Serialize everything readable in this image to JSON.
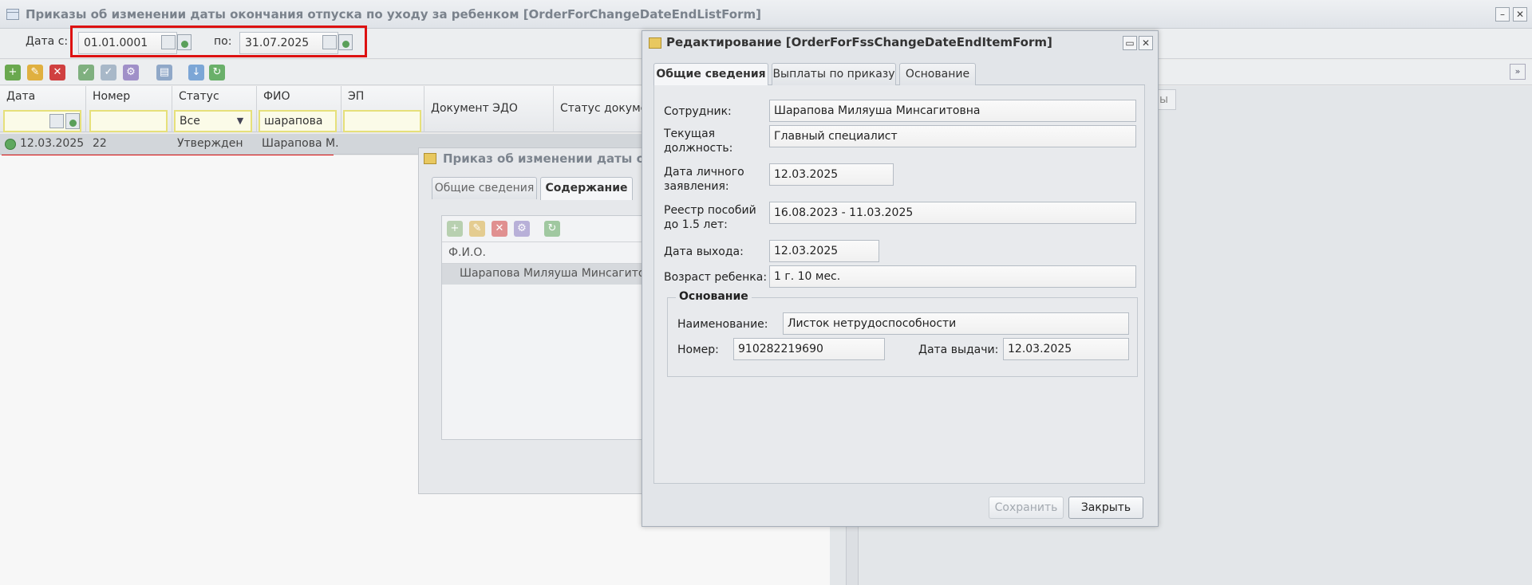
{
  "main_window": {
    "title": "Приказы об изменении даты окончания отпуска по уходу за ребенком [OrderForChangeDateEndListForm]",
    "minimize_glyph": "–",
    "close_glyph": "✕"
  },
  "filter": {
    "date_from_label": "Дата с:",
    "date_from_value": "01.01.0001",
    "date_to_label": "по:",
    "date_to_value": "31.07.2025"
  },
  "toolbar": {
    "icons": [
      "add-icon",
      "edit-icon",
      "delete-icon",
      "approve-icon",
      "unapprove-icon",
      "actions-icon",
      "print-icon",
      "export-icon",
      "refresh-icon"
    ]
  },
  "grid": {
    "columns": [
      "Дата",
      "Номер",
      "Статус",
      "ФИО",
      "ЭП",
      "Документ ЭДО",
      "Статус документ"
    ],
    "filters": {
      "status_value": "Все",
      "fio_value": "шарапова"
    },
    "rows": [
      {
        "date": "12.03.2025",
        "number": "22",
        "status": "Утвержден",
        "fio": "Шарапова М..."
      }
    ]
  },
  "bg_window": {
    "title": "Приказ об изменении даты оконча",
    "tabs": [
      "Общие сведения",
      "Содержание"
    ],
    "column": "Ф.И.О.",
    "row": "Шарапова Миляуша Минсагитовна",
    "right_tab_fragment": "ы"
  },
  "modal": {
    "title": "Редактирование [OrderForFssChangeDateEndItemForm]",
    "tabs": [
      "Общие сведения",
      "Выплаты по приказу",
      "Основание"
    ],
    "fields": {
      "employee_label": "Сотрудник:",
      "employee_value": "Шарапова Миляуша Минсагитовна",
      "position_label_1": "Текущая",
      "position_label_2": "должность:",
      "position_value": "Главный специалист",
      "app_date_label_1": "Дата личного",
      "app_date_label_2": "заявления:",
      "app_date_value": "12.03.2025",
      "registry_label_1": "Реестр пособий",
      "registry_label_2": "до 1.5 лет:",
      "registry_value": "16.08.2023 - 11.03.2025",
      "return_date_label": "Дата выхода:",
      "return_date_value": "12.03.2025",
      "child_age_label": "Возраст ребенка:",
      "child_age_value": "1 г. 10 мес."
    },
    "basis": {
      "legend": "Основание",
      "name_label": "Наименование:",
      "name_value": "Листок нетрудоспособности",
      "number_label": "Номер:",
      "number_value": "910282219690",
      "issue_date_label": "Дата выдачи:",
      "issue_date_value": "12.03.2025"
    },
    "buttons": {
      "save": "Сохранить",
      "close": "Закрыть"
    }
  }
}
